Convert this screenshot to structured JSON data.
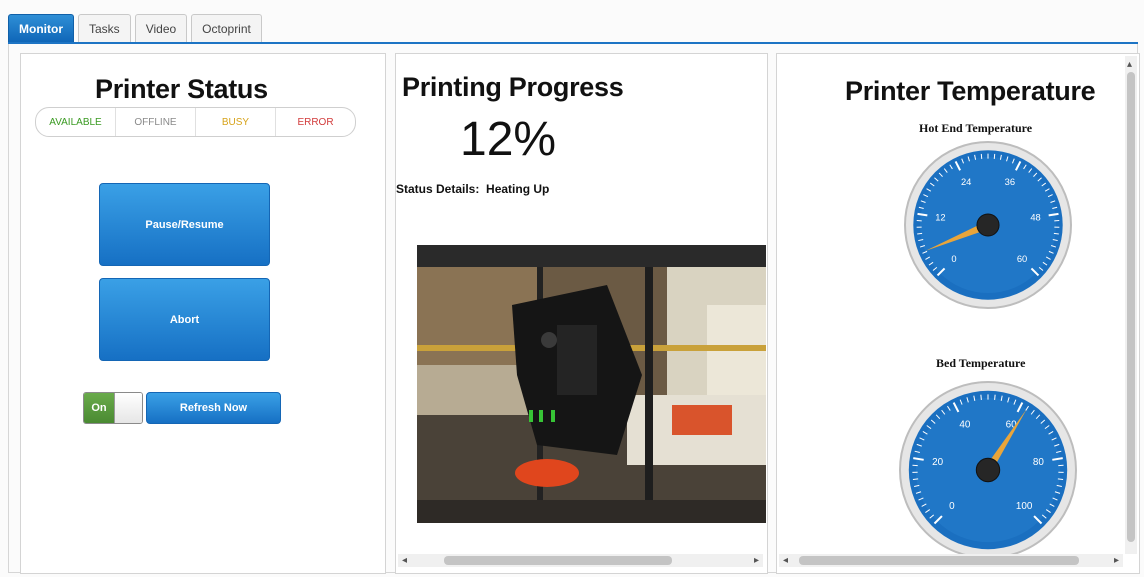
{
  "tabs": [
    {
      "label": "Monitor",
      "active": true
    },
    {
      "label": "Tasks",
      "active": false
    },
    {
      "label": "Video",
      "active": false
    },
    {
      "label": "Octoprint",
      "active": false
    }
  ],
  "status_panel": {
    "title": "Printer Status",
    "states": [
      {
        "label": "AVAILABLE",
        "color": "#3a9a22"
      },
      {
        "label": "OFFLINE",
        "color": "#8a8a8a"
      },
      {
        "label": "BUSY",
        "color": "#d7a31a"
      },
      {
        "label": "ERROR",
        "color": "#d23a3a"
      }
    ],
    "pause_resume_label": "Pause/Resume",
    "abort_label": "Abort",
    "toggle_label": "On",
    "refresh_label": "Refresh Now"
  },
  "progress_panel": {
    "title": "Printing Progress",
    "percent_text": "12%",
    "percent": 12,
    "status_details_label": "Status Details:",
    "status_details_value": "Heating Up"
  },
  "temperature_panel": {
    "title": "Printer Temperature",
    "hot_end": {
      "label": "Hot End Temperature",
      "ticks": [
        "0",
        "12",
        "24",
        "36",
        "48",
        "60"
      ],
      "min": 0,
      "max": 60,
      "value": 5
    },
    "bed": {
      "label": "Bed Temperature",
      "ticks": [
        "0",
        "20",
        "40",
        "60",
        "80",
        "100"
      ],
      "min": 0,
      "max": 100,
      "value": 62
    }
  },
  "colors": {
    "accent": "#1670c4",
    "gauge_face": "#1a6fc0",
    "needle": "#e9a53a"
  }
}
